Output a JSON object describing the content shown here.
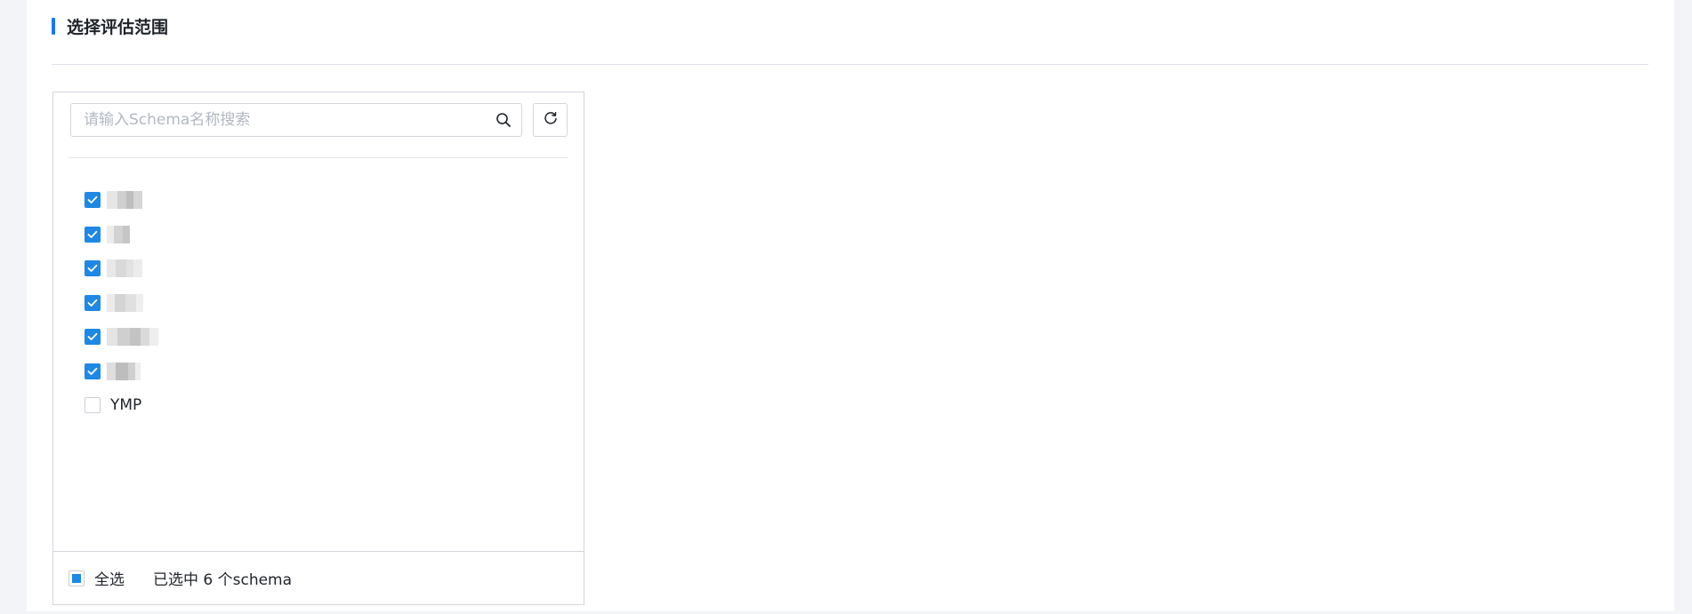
{
  "section": {
    "title": "选择评估范围"
  },
  "search": {
    "placeholder": "请输入Schema名称搜索",
    "value": ""
  },
  "schema_list": {
    "items": [
      {
        "label": "",
        "checked": true,
        "redacted": true
      },
      {
        "label": "",
        "checked": true,
        "redacted": true
      },
      {
        "label": "",
        "checked": true,
        "redacted": true
      },
      {
        "label": "",
        "checked": true,
        "redacted": true
      },
      {
        "label": "",
        "checked": true,
        "redacted": true
      },
      {
        "label": "",
        "checked": true,
        "redacted": true
      },
      {
        "label": "YMP",
        "checked": false,
        "redacted": false
      }
    ]
  },
  "footer": {
    "select_all_label": "全选",
    "select_all_state": "indeterminate",
    "selected_count_text": "已选中 6 个schema"
  },
  "colors": {
    "accent": "#1677ff",
    "checkbox_checked": "#1e88e5",
    "border": "#d3d6dc",
    "page_bg": "#f3f4f7"
  },
  "icons": {
    "search": "search-icon",
    "refresh": "refresh-icon",
    "check": "check-icon"
  }
}
